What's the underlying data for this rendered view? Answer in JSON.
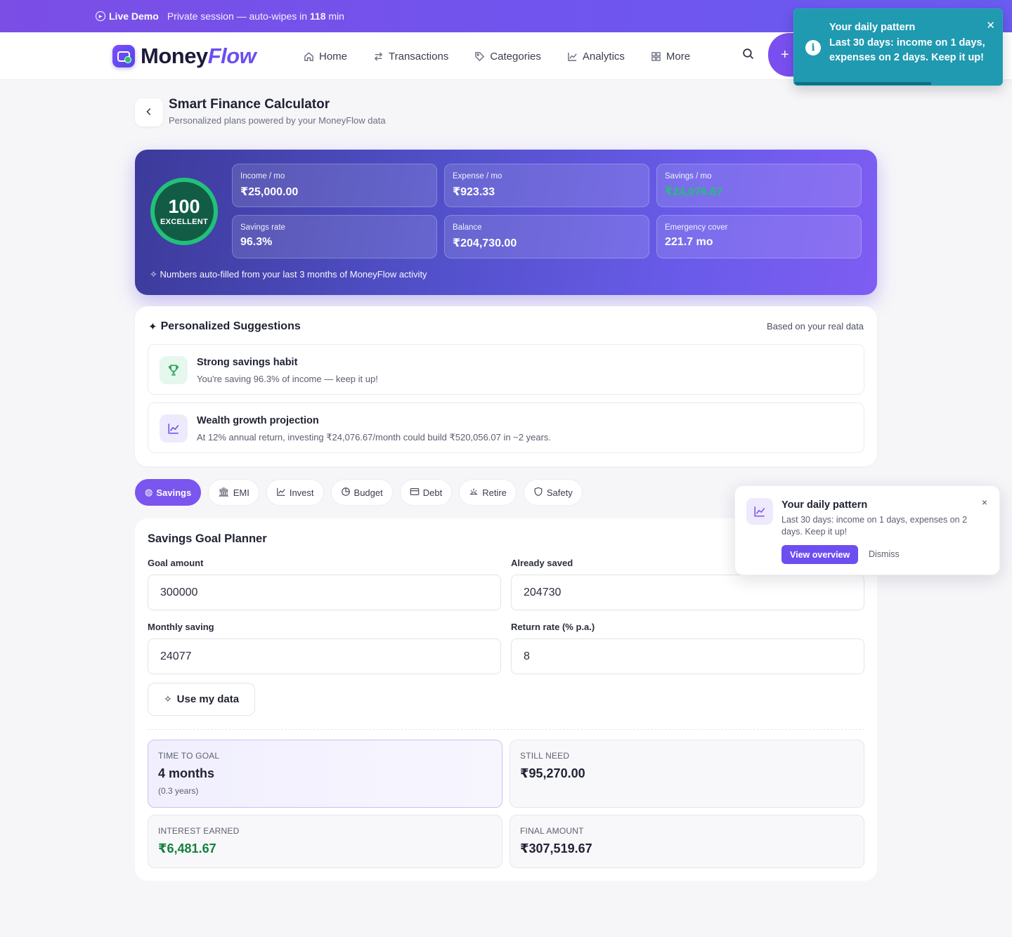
{
  "banner": {
    "live_label": "Live Demo",
    "session_prefix": "Private session — auto-wipes in ",
    "session_minutes": "118",
    "session_suffix": " min"
  },
  "brand": {
    "name_a": "Money",
    "name_b": "Flow"
  },
  "nav": {
    "items": [
      {
        "label": "Home",
        "icon": "home-icon"
      },
      {
        "label": "Transactions",
        "icon": "transfer-icon"
      },
      {
        "label": "Categories",
        "icon": "tag-icon"
      },
      {
        "label": "Analytics",
        "icon": "chart-line-icon"
      },
      {
        "label": "More",
        "icon": "grid-icon"
      }
    ],
    "add_label": "+"
  },
  "toast": {
    "title": "Your daily pattern",
    "message": "Last 30 days: income on 1 days, expenses on 2 days. Keep it up!",
    "close": "✕",
    "progress": 0.66
  },
  "page": {
    "title": "Smart Finance Calculator",
    "subtitle": "Personalized plans powered by your MoneyFlow data"
  },
  "hero": {
    "score": "100",
    "score_label": "EXCELLENT",
    "stats": [
      {
        "label": "Income / mo",
        "value": "₹25,000.00"
      },
      {
        "label": "Expense / mo",
        "value": "₹923.33"
      },
      {
        "label": "Savings / mo",
        "value": "₹24,076.67"
      },
      {
        "label": "Savings rate",
        "value": "96.3%"
      },
      {
        "label": "Balance",
        "value": "₹204,730.00"
      },
      {
        "label": "Emergency cover",
        "value": "221.7 mo"
      }
    ],
    "note": "Numbers auto-filled from your last 3 months of MoneyFlow activity"
  },
  "suggestions": {
    "title": "Personalized Suggestions",
    "right_label": "Based on your real data",
    "items": [
      {
        "title": "Strong savings habit",
        "desc": "You're saving 96.3% of income — keep it up!",
        "icon": "trophy-icon"
      },
      {
        "title": "Wealth growth projection",
        "desc": "At 12% annual return, investing ₹24,076.67/month could build ₹520,056.07 in ~2 years.",
        "icon": "chart-line-icon"
      }
    ]
  },
  "tabs": [
    {
      "label": "Savings",
      "active": true
    },
    {
      "label": "EMI"
    },
    {
      "label": "Invest"
    },
    {
      "label": "Budget"
    },
    {
      "label": "Debt"
    },
    {
      "label": "Retire"
    },
    {
      "label": "Safety"
    }
  ],
  "planner": {
    "title": "Savings Goal Planner",
    "fields": {
      "goal_label": "Goal amount",
      "goal_value": "300000",
      "saved_label": "Already saved",
      "saved_value": "204730",
      "monthly_label": "Monthly saving",
      "monthly_value": "24077",
      "rate_label": "Return rate (% p.a.)",
      "rate_value": "8"
    },
    "use_data_label": "Use my data",
    "results": {
      "time_label": "TIME TO GOAL",
      "time_value": "4 months",
      "time_sub": "(0.3 years)",
      "need_label": "STILL NEED",
      "need_value": "₹95,270.00",
      "interest_label": "INTEREST EARNED",
      "interest_value": "₹6,481.67",
      "final_label": "FINAL AMOUNT",
      "final_value": "₹307,519.67"
    }
  },
  "popup": {
    "title": "Your daily pattern",
    "message": "Last 30 days: income on 1 days, expenses on 2 days. Keep it up!",
    "primary": "View overview",
    "secondary": "Dismiss",
    "close": "×"
  },
  "colors": {
    "accent": "#7a55ee",
    "toast": "#1f9ab0",
    "positive": "#22c07a"
  }
}
